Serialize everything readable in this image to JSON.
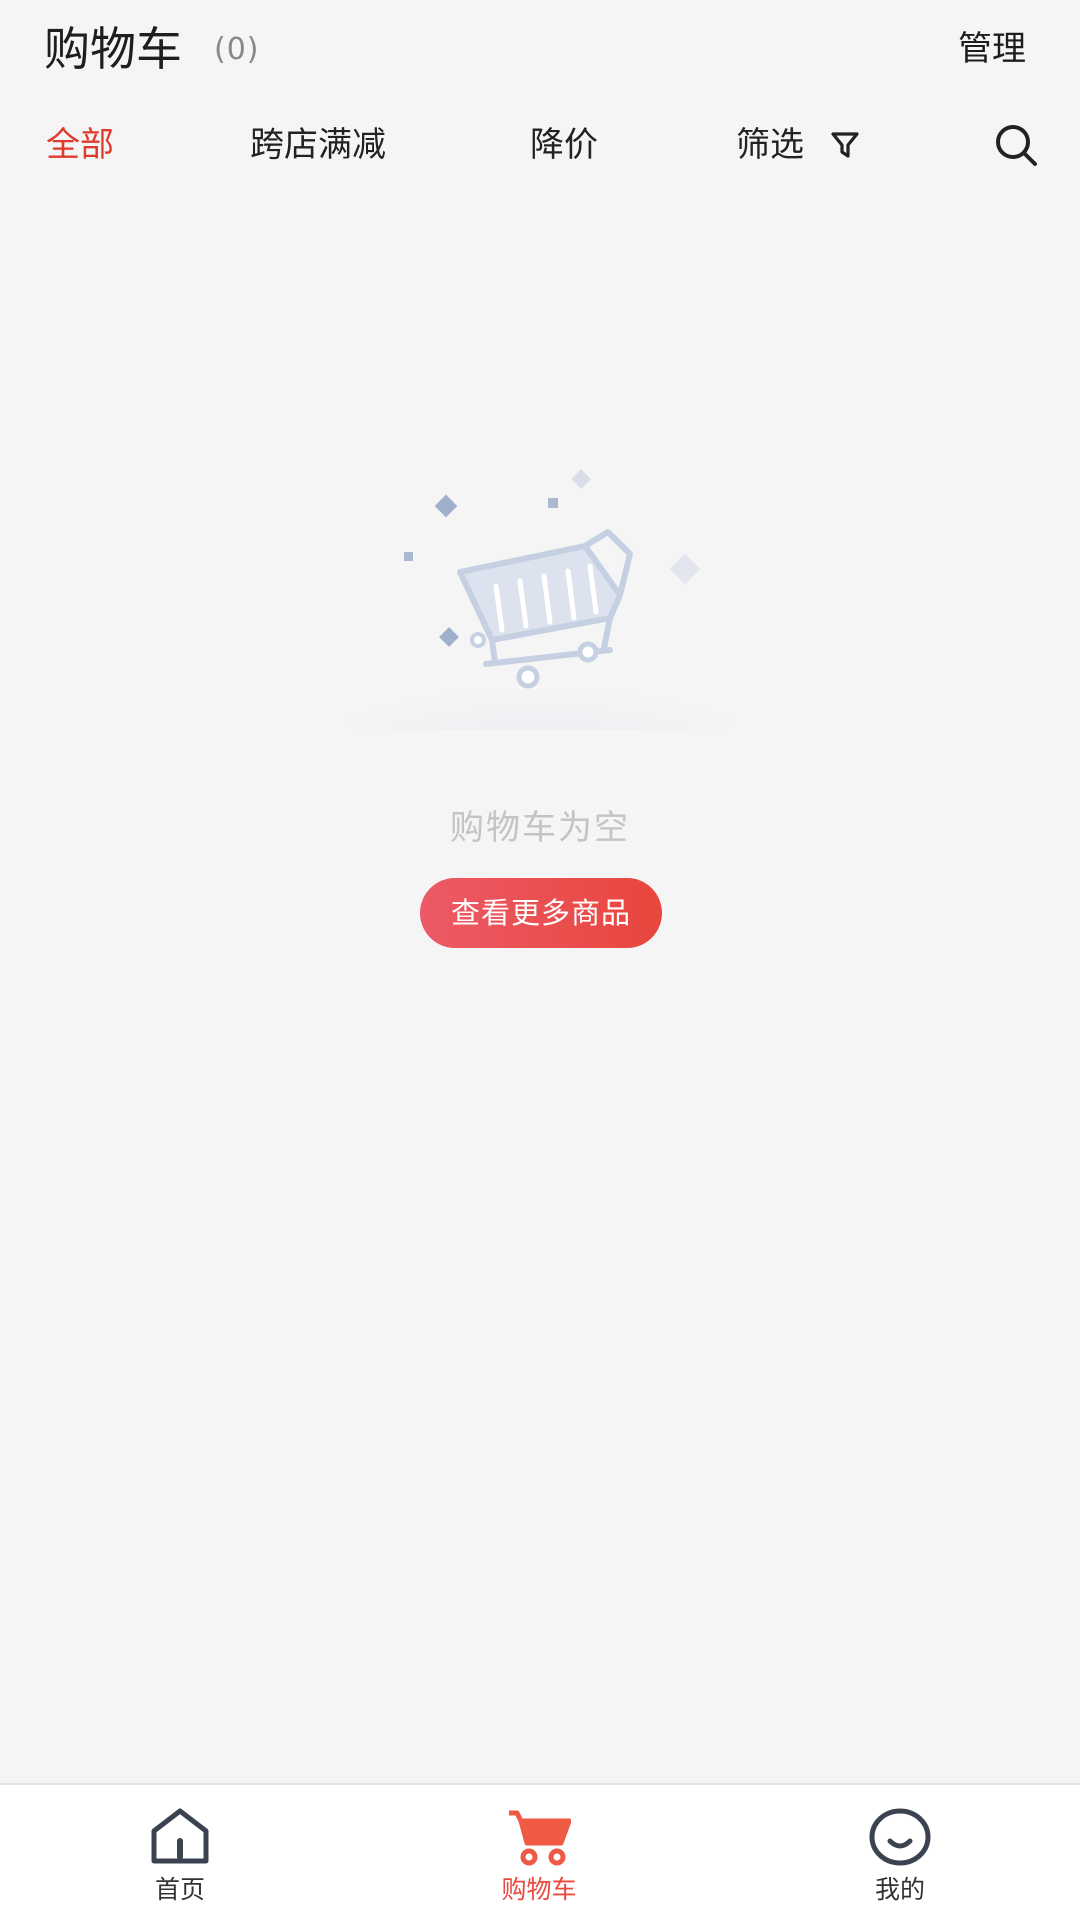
{
  "header": {
    "title": "购物车",
    "count": "(0)",
    "manage_label": "管理"
  },
  "tabs": [
    {
      "label": "全部",
      "active": true
    },
    {
      "label": "跨店满减",
      "active": false
    },
    {
      "label": "降价",
      "active": false
    },
    {
      "label": "筛选",
      "active": false,
      "icon": "funnel-icon"
    }
  ],
  "search": {
    "icon": "search-icon"
  },
  "empty_state": {
    "illustration": "empty-cart-illustration",
    "message": "购物车为空",
    "button_label": "查看更多商品"
  },
  "bottom_nav": [
    {
      "label": "首页",
      "icon": "home-icon",
      "active": false
    },
    {
      "label": "购物车",
      "icon": "cart-icon",
      "active": true
    },
    {
      "label": "我的",
      "icon": "smiley-profile-icon",
      "active": false
    }
  ],
  "colors": {
    "accent": "#e03a2c",
    "button_gradient_start": "#ec5a66",
    "button_gradient_end": "#e8463d",
    "background": "#f5f5f5",
    "muted_text": "#c3c3c8"
  }
}
